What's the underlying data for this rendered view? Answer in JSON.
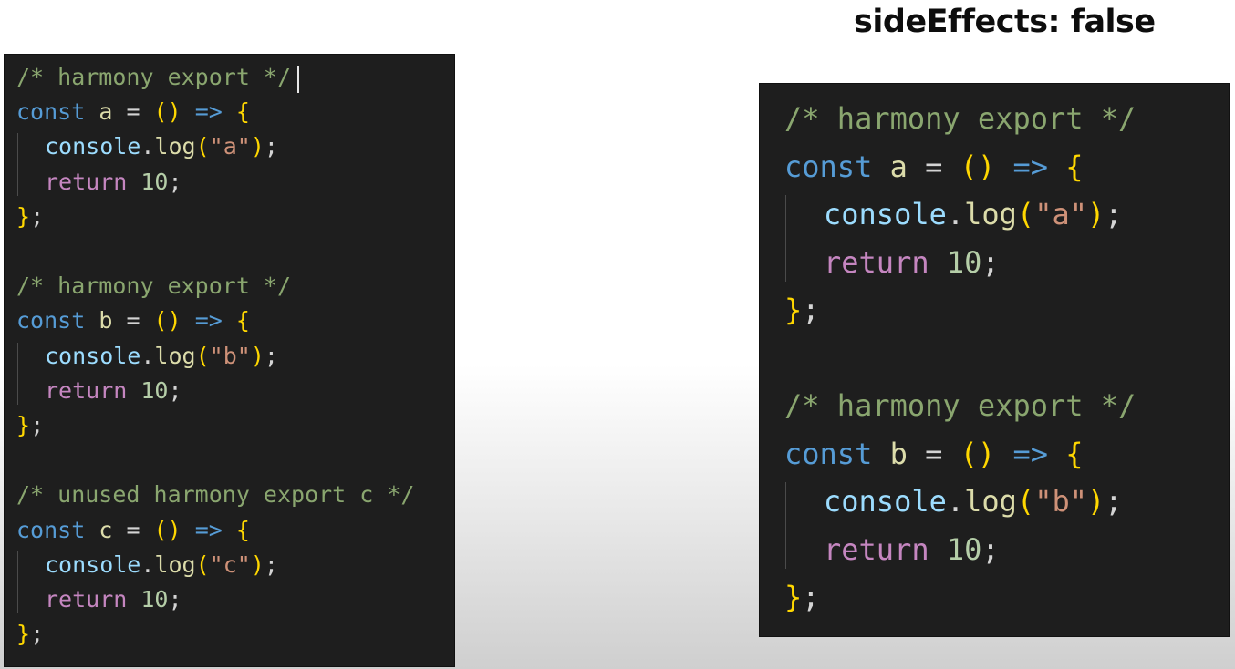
{
  "heading": "sideEffects: false",
  "left_blocks": [
    {
      "comment": "/* harmony export */",
      "name": "a",
      "arg": "a"
    },
    {
      "comment": "/* harmony export */",
      "name": "b",
      "arg": "b"
    },
    {
      "comment": "/* unused harmony export c */",
      "name": "c",
      "arg": "c"
    }
  ],
  "right_blocks": [
    {
      "comment": "/* harmony export */",
      "name": "a",
      "arg": "a"
    },
    {
      "comment": "/* harmony export */",
      "name": "b",
      "arg": "b"
    }
  ],
  "tokens": {
    "const": "const",
    "eq": " = ",
    "paren_open": "(",
    "paren_close": ")",
    "arrow": " => ",
    "brace_open": "{",
    "brace_close": "}",
    "semicolon": ";",
    "console": "console",
    "dot": ".",
    "log": "log",
    "quote": "\"",
    "return": "return",
    "ret_value": "10"
  }
}
